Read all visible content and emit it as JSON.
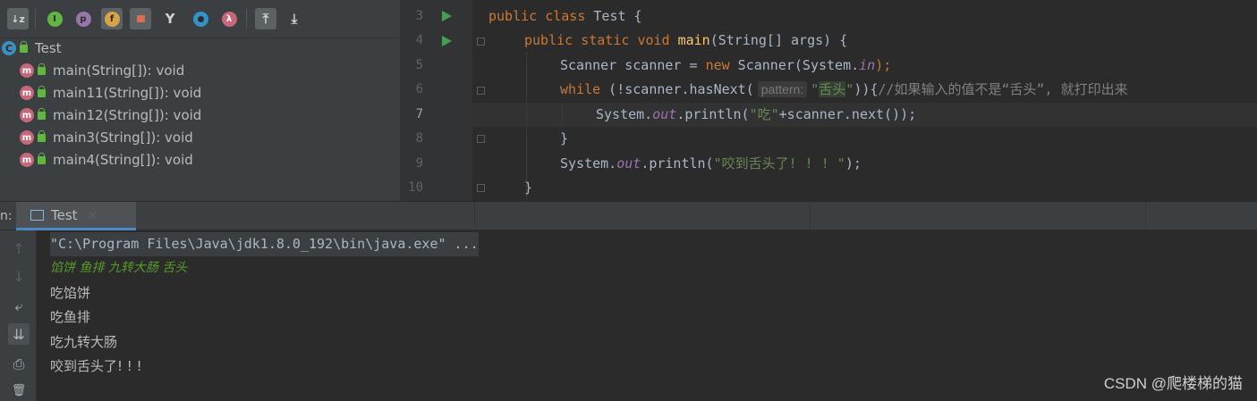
{
  "structure": {
    "toolbar": [
      {
        "name": "sort-alpha-icon",
        "glyph": "↓z"
      },
      {
        "name": "inherited-icon",
        "glyph": "I"
      },
      {
        "name": "show-properties-icon",
        "glyph": "p"
      },
      {
        "name": "show-fields-icon",
        "glyph": "f"
      },
      {
        "name": "show-non-public-icon",
        "glyph": "🔒"
      },
      {
        "name": "show-lambdas-icon",
        "glyph": "Y"
      },
      {
        "name": "anonymous-classes-icon",
        "glyph": "●"
      },
      {
        "name": "lambda-icon",
        "glyph": "λ"
      },
      {
        "name": "autoscroll-to-source-icon",
        "glyph": "⤒"
      },
      {
        "name": "autoscroll-from-source-icon",
        "glyph": "⤓"
      }
    ],
    "class_name": "Test",
    "methods": [
      "main(String[]): void",
      "main11(String[]): void",
      "main12(String[]): void",
      "main3(String[]): void",
      "main4(String[]): void"
    ]
  },
  "editor": {
    "line_numbers": [
      "3",
      "4",
      "5",
      "6",
      "7",
      "8",
      "9",
      "10"
    ],
    "line3": {
      "kw1": "public",
      "kw2": "class",
      "name": "Test {"
    },
    "line4": {
      "kw1": "public",
      "kw2": "static",
      "kw3": "void",
      "fn": "main",
      "rest": "(String[] args) {"
    },
    "line5": {
      "a": "Scanner scanner = ",
      "kw": "new",
      "b": " Scanner(System.",
      "fld": "in",
      "c": ");"
    },
    "line6": {
      "kw": "while",
      "a": " (!scanner.hasNext(",
      "hint": "pattern:",
      "str_q1": "\"",
      "str_word": "舌头",
      "str_q2": "\"",
      "b": ")){",
      "cmt": "//如果输入的值不是“舌头”, 就打印出来"
    },
    "line7": {
      "a": "System.",
      "fld": "out",
      "b": ".println(",
      "str": "\"吃\"",
      "c": "+scanner.next());"
    },
    "line8": {
      "a": "}"
    },
    "line9": {
      "a": "System.",
      "fld": "out",
      "b": ".println(",
      "str": "\"咬到舌头了! ! ! \"",
      "c": ");"
    },
    "line10": {
      "a": "}"
    }
  },
  "run": {
    "label": "n:",
    "tab_label": "Test",
    "close_glyph": "×",
    "side_buttons": [
      {
        "name": "up-stack-frame-icon",
        "glyph": "↑"
      },
      {
        "name": "down-stack-frame-icon",
        "glyph": "↓"
      },
      {
        "name": "soft-wrap-icon",
        "glyph": "⤶"
      },
      {
        "name": "scroll-to-end-icon",
        "glyph": "⇊"
      },
      {
        "name": "print-icon",
        "glyph": "⎙"
      },
      {
        "name": "clear-all-icon",
        "glyph": "🗑"
      }
    ],
    "console": [
      "\"C:\\Program Files\\Java\\jdk1.8.0_192\\bin\\java.exe\" ...",
      "馅饼 鱼排 九转大肠 舌头",
      "吃馅饼",
      "吃鱼排",
      "吃九转大肠",
      "咬到舌头了! ! !"
    ]
  },
  "watermark": "CSDN @爬楼梯的猫",
  "colors": {
    "accent": "#4a88c7",
    "run_arrow": "#499c54",
    "keyword": "#cc7832",
    "string": "#6a8759",
    "input_text": "#569b2a"
  }
}
